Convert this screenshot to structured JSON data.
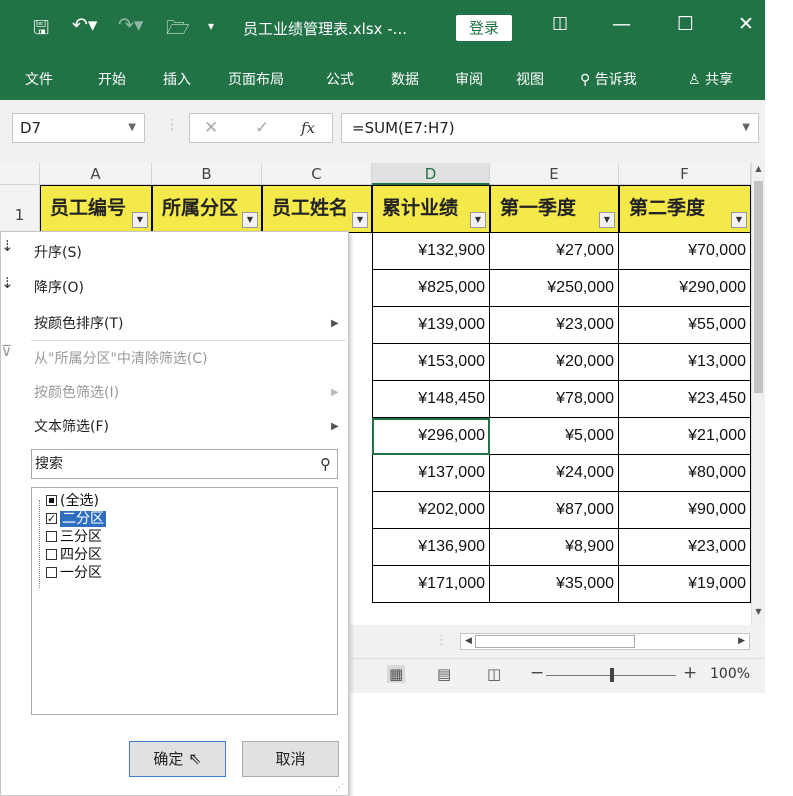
{
  "titlebar": {
    "title": "员工业绩管理表.xlsx -...",
    "login": "登录",
    "minimize": "—",
    "maximize": "☐",
    "close": "✕"
  },
  "ribbon": {
    "tabs": [
      "文件",
      "开始",
      "插入",
      "页面布局",
      "公式",
      "数据",
      "审阅",
      "视图",
      "告诉我",
      "共享"
    ]
  },
  "formula_bar": {
    "name_box": "D7",
    "fx": "fx",
    "formula": "=SUM(E7:H7)"
  },
  "grid": {
    "columns": [
      "A",
      "B",
      "C",
      "D",
      "E",
      "F"
    ],
    "row1_number": "1",
    "headers": [
      "员工编号",
      "所属分区",
      "员工姓名",
      "累计业绩",
      "第一季度",
      "第二季度"
    ],
    "rows": [
      [
        "¥132,900",
        "¥27,000",
        "¥70,000"
      ],
      [
        "¥825,000",
        "¥250,000",
        "¥290,000"
      ],
      [
        "¥139,000",
        "¥23,000",
        "¥55,000"
      ],
      [
        "¥153,000",
        "¥20,000",
        "¥13,000"
      ],
      [
        "¥148,450",
        "¥78,000",
        "¥23,450"
      ],
      [
        "¥296,000",
        "¥5,000",
        "¥21,000"
      ],
      [
        "¥137,000",
        "¥24,000",
        "¥80,000"
      ],
      [
        "¥202,000",
        "¥87,000",
        "¥90,000"
      ],
      [
        "¥136,900",
        "¥8,900",
        "¥23,000"
      ],
      [
        "¥171,000",
        "¥35,000",
        "¥19,000"
      ]
    ]
  },
  "statusbar": {
    "zoom": "100%"
  },
  "filter_menu": {
    "sort_asc": "升序(S)",
    "sort_desc": "降序(O)",
    "sort_by_color": "按颜色排序(T)",
    "clear_filter": "从\"所属分区\"中清除筛选(C)",
    "filter_by_color": "按颜色筛选(I)",
    "text_filter": "文本筛选(F)",
    "search_placeholder": "搜索",
    "items": [
      "(全选)",
      "二分区",
      "三分区",
      "四分区",
      "一分区"
    ],
    "ok": "确定",
    "cancel": "取消"
  }
}
